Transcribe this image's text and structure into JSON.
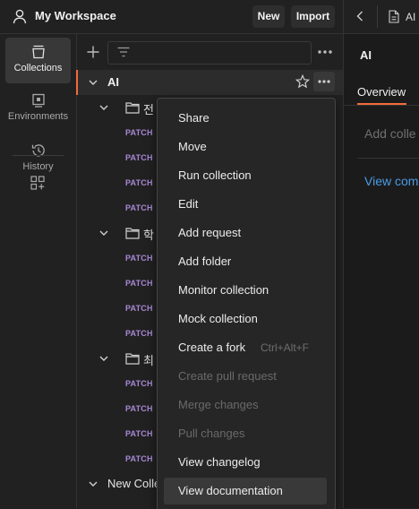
{
  "header": {
    "workspace_title": "My Workspace",
    "new_label": "New",
    "import_label": "Import"
  },
  "sidebar": {
    "items": [
      {
        "label": "Collections",
        "icon": "collections-icon"
      },
      {
        "label": "Environments",
        "icon": "environments-icon"
      },
      {
        "label": "History",
        "icon": "history-icon"
      }
    ]
  },
  "tree": {
    "collection_name": "AI",
    "folders": [
      {
        "name": "전",
        "requests": [
          "PATCH",
          "PATCH",
          "PATCH",
          "PATCH"
        ]
      },
      {
        "name": "학",
        "requests": [
          "PATCH",
          "PATCH",
          "PATCH",
          "PATCH"
        ]
      },
      {
        "name": "최",
        "requests": [
          "PATCH",
          "PATCH",
          "PATCH",
          "PATCH"
        ]
      }
    ],
    "second_collection": "New Colle"
  },
  "context_menu": {
    "items": [
      {
        "label": "Share",
        "enabled": true
      },
      {
        "label": "Move",
        "enabled": true
      },
      {
        "label": "Run collection",
        "enabled": true
      },
      {
        "label": "Edit",
        "enabled": true
      },
      {
        "label": "Add request",
        "enabled": true
      },
      {
        "label": "Add folder",
        "enabled": true
      },
      {
        "label": "Monitor collection",
        "enabled": true
      },
      {
        "label": "Mock collection",
        "enabled": true
      },
      {
        "label": "Create a fork",
        "enabled": true,
        "shortcut": "Ctrl+Alt+F"
      },
      {
        "label": "Create pull request",
        "enabled": false
      },
      {
        "label": "Merge changes",
        "enabled": false
      },
      {
        "label": "Pull changes",
        "enabled": false
      },
      {
        "label": "View changelog",
        "enabled": true
      },
      {
        "label": "View documentation",
        "enabled": true,
        "highlighted": true
      }
    ]
  },
  "right_panel": {
    "tab_label": "AI",
    "title": "AI",
    "tab_overview": "Overview",
    "description_placeholder": "Add colle",
    "link_text": "View com"
  },
  "colors": {
    "accent": "#f26b3a",
    "link": "#4a9be6",
    "method_patch": "#a889d6"
  }
}
